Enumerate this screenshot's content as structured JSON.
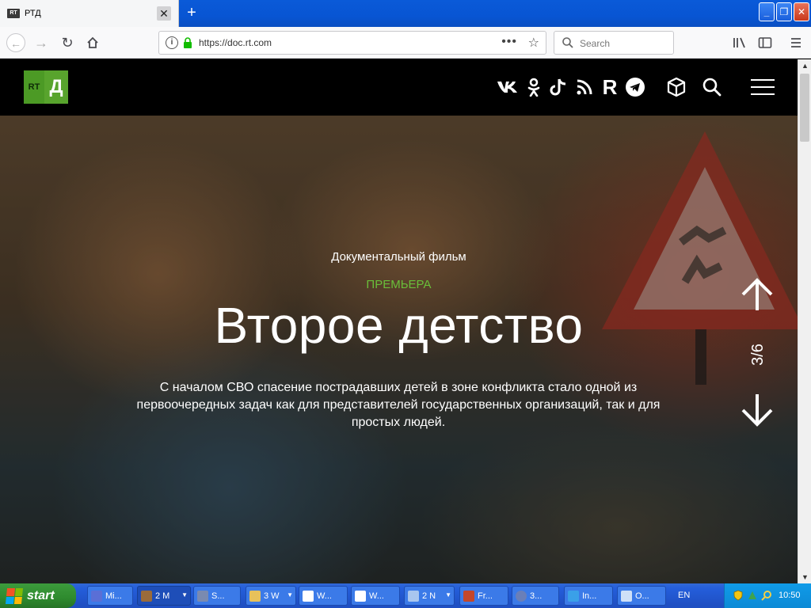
{
  "browser": {
    "tab_title": "РТД",
    "tab_favicon_text": "RT",
    "url": "https://doc.rt.com",
    "search_placeholder": "Search"
  },
  "site": {
    "logo_rt": "RT",
    "logo_d": "Д",
    "social_icons": [
      "vk-icon",
      "odnoklassniki-icon",
      "tiktok-icon",
      "rss-icon",
      "rutube-icon",
      "telegram-icon",
      "3d-cube-icon",
      "search-icon"
    ],
    "social_r_label": "R"
  },
  "hero": {
    "subtitle": "Документальный фильм",
    "tag": "ПРЕМЬЕРА",
    "title": "Второе детство",
    "description": "С началом СВО спасение пострадавших детей в зоне конфликта стало одной из первоочередных задач как для представителей государственных организаций, так и для простых людей.",
    "pager": "3/6",
    "tag_color": "#6abf3a"
  },
  "colors": {
    "logo_green": "#58a42d",
    "header_bg": "#000000"
  },
  "taskbar": {
    "start_label": "start",
    "tasks": [
      {
        "label": "Mi..."
      },
      {
        "label": "2 M"
      },
      {
        "label": "S..."
      },
      {
        "label": "3 W"
      },
      {
        "label": "W..."
      },
      {
        "label": "W..."
      },
      {
        "label": "2 N"
      },
      {
        "label": "Fr..."
      },
      {
        "label": "3..."
      },
      {
        "label": "In..."
      },
      {
        "label": "O..."
      }
    ],
    "language": "EN",
    "clock": "10:50"
  }
}
